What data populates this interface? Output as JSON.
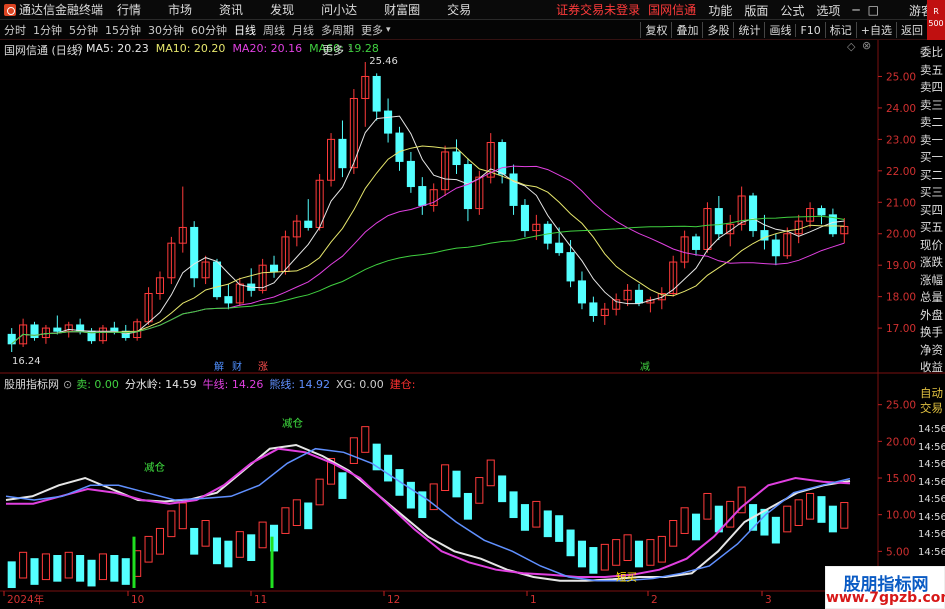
{
  "menubar": {
    "app_title": "通达信金融终端",
    "menus": [
      "行情",
      "市场",
      "资讯",
      "发现",
      "问小达",
      "财富圈",
      "交易"
    ],
    "warning": "证券交易未登录",
    "stock_name": "国网信通",
    "right_menus": [
      "功能",
      "版面",
      "公式",
      "选项"
    ],
    "guest": "游客"
  },
  "toolbar": {
    "timeframes": [
      "分时",
      "1分钟",
      "5分钟",
      "15分钟",
      "30分钟",
      "60分钟",
      "日线",
      "周线",
      "月线",
      "多周期",
      "更多"
    ],
    "active_timeframe": "日线",
    "right_buttons": [
      "复权",
      "叠加",
      "多股",
      "统计",
      "画线",
      "F10",
      "标记",
      "+自选",
      "返回"
    ],
    "corner_label": "R 500"
  },
  "main_chart": {
    "title": "国网信通 (日线)",
    "legend": [
      {
        "label": "MA5: 20.23",
        "color": "#e6e6e6"
      },
      {
        "label": "MA10: 20.20",
        "color": "#e6e66c"
      },
      {
        "label": "MA20: 20.16",
        "color": "#e040e0"
      },
      {
        "label": "MA60: 19.28",
        "color": "#40d040"
      }
    ],
    "more": "更多",
    "high_label": "25.46",
    "low_label": "16.24",
    "price_axis": [
      "25.00",
      "24.00",
      "23.00",
      "22.00",
      "21.00",
      "20.00",
      "19.00",
      "18.00",
      "17.00"
    ],
    "markers": [
      {
        "text": "解",
        "color": "#4f8fff"
      },
      {
        "text": "财",
        "color": "#4f8fff"
      },
      {
        "text": "涨",
        "color": "#ff4f4f"
      },
      {
        "text": "减",
        "color": "#40d040"
      }
    ]
  },
  "indicator": {
    "title": "股朋指标网",
    "legend": [
      {
        "label": "卖: 0.00",
        "color": "#40d040"
      },
      {
        "label": "分水岭: 14.59",
        "color": "#e6e6e6"
      },
      {
        "label": "牛线: 14.26",
        "color": "#e040e0"
      },
      {
        "label": "熊线: 14.92",
        "color": "#6090ff"
      },
      {
        "label": "XG: 0.00",
        "color": "#cccccc"
      },
      {
        "label": "建仓:",
        "color": "#ff3030"
      }
    ],
    "axis": [
      "25.00",
      "20.00",
      "15.00",
      "10.00",
      "5.00"
    ],
    "notes": [
      {
        "text": "减仓",
        "color": "#40e040"
      },
      {
        "text": "减仓",
        "color": "#40e040"
      },
      {
        "text": "短买",
        "color": "#ffe000"
      }
    ]
  },
  "date_axis": [
    "2024年",
    "10",
    "11",
    "12",
    "1",
    "2",
    "3"
  ],
  "right_panel": {
    "items": [
      "委比",
      "卖五",
      "卖四",
      "卖三",
      "卖二",
      "卖一",
      "买一",
      "买二",
      "买三",
      "买四",
      "买五",
      "现价",
      "涨跌",
      "涨幅",
      "总量",
      "外盘",
      "换手",
      "净资",
      "收益"
    ],
    "auto_trade": "自动交易",
    "times": [
      "14:56",
      "14:56",
      "14:56",
      "14:56",
      "14:56",
      "14:56",
      "14:56",
      "14:56"
    ]
  },
  "watermark": {
    "line1": "股朋指标网",
    "line2": "www.7gpzb.com"
  },
  "chart_data": {
    "type": "candlestick",
    "price_range": [
      16.24,
      25.46
    ],
    "ohlc": [
      [
        16.8,
        17.0,
        16.24,
        16.5
      ],
      [
        16.5,
        17.3,
        16.4,
        17.1
      ],
      [
        17.1,
        17.2,
        16.6,
        16.7
      ],
      [
        16.7,
        17.1,
        16.5,
        17.0
      ],
      [
        17.0,
        17.4,
        16.8,
        16.9
      ],
      [
        16.9,
        17.2,
        16.7,
        17.1
      ],
      [
        17.1,
        17.3,
        16.8,
        16.9
      ],
      [
        16.9,
        17.0,
        16.5,
        16.6
      ],
      [
        16.6,
        17.1,
        16.5,
        17.0
      ],
      [
        17.0,
        17.2,
        16.8,
        16.9
      ],
      [
        16.9,
        17.1,
        16.6,
        16.7
      ],
      [
        16.7,
        17.3,
        16.6,
        17.2
      ],
      [
        17.2,
        18.3,
        17.1,
        18.1
      ],
      [
        18.1,
        18.8,
        17.9,
        18.6
      ],
      [
        18.6,
        19.9,
        18.4,
        19.7
      ],
      [
        19.7,
        21.5,
        19.4,
        20.2
      ],
      [
        20.2,
        20.4,
        18.3,
        18.6
      ],
      [
        18.6,
        19.3,
        18.4,
        19.1
      ],
      [
        19.1,
        19.2,
        17.9,
        18.0
      ],
      [
        18.0,
        18.4,
        17.6,
        17.8
      ],
      [
        17.8,
        18.6,
        17.7,
        18.4
      ],
      [
        18.4,
        18.9,
        18.0,
        18.2
      ],
      [
        18.2,
        19.2,
        18.1,
        19.0
      ],
      [
        19.0,
        19.3,
        18.6,
        18.8
      ],
      [
        18.8,
        20.1,
        18.7,
        19.9
      ],
      [
        19.9,
        20.6,
        19.6,
        20.4
      ],
      [
        20.4,
        21.1,
        20.1,
        20.2
      ],
      [
        20.2,
        21.9,
        20.1,
        21.7
      ],
      [
        21.7,
        23.2,
        21.5,
        23.0
      ],
      [
        23.0,
        23.6,
        21.8,
        22.1
      ],
      [
        22.1,
        24.6,
        21.9,
        24.3
      ],
      [
        24.3,
        25.46,
        23.4,
        25.0
      ],
      [
        25.0,
        25.1,
        23.6,
        23.9
      ],
      [
        23.9,
        24.3,
        22.9,
        23.2
      ],
      [
        23.2,
        23.4,
        22.0,
        22.3
      ],
      [
        22.3,
        22.6,
        21.3,
        21.5
      ],
      [
        21.5,
        21.8,
        20.6,
        20.9
      ],
      [
        20.9,
        21.6,
        20.7,
        21.4
      ],
      [
        21.4,
        22.8,
        21.2,
        22.6
      ],
      [
        22.6,
        23.0,
        21.9,
        22.2
      ],
      [
        22.2,
        22.4,
        20.4,
        20.8
      ],
      [
        20.8,
        22.0,
        20.6,
        21.8
      ],
      [
        21.8,
        23.2,
        21.6,
        22.9
      ],
      [
        22.9,
        23.0,
        21.6,
        21.9
      ],
      [
        21.9,
        22.2,
        20.6,
        20.9
      ],
      [
        20.9,
        21.1,
        19.9,
        20.1
      ],
      [
        20.1,
        20.6,
        19.8,
        20.3
      ],
      [
        20.3,
        20.4,
        19.5,
        19.7
      ],
      [
        19.7,
        20.2,
        19.3,
        19.4
      ],
      [
        19.4,
        19.8,
        18.3,
        18.5
      ],
      [
        18.5,
        18.8,
        17.6,
        17.8
      ],
      [
        17.8,
        18.0,
        17.2,
        17.4
      ],
      [
        17.4,
        17.8,
        17.1,
        17.6
      ],
      [
        17.6,
        18.1,
        17.4,
        17.9
      ],
      [
        17.9,
        18.4,
        17.7,
        18.2
      ],
      [
        18.2,
        18.4,
        17.7,
        17.8
      ],
      [
        17.8,
        18.0,
        17.5,
        17.9
      ],
      [
        17.9,
        18.3,
        17.6,
        18.1
      ],
      [
        18.1,
        19.3,
        18.0,
        19.1
      ],
      [
        19.1,
        20.1,
        18.9,
        19.9
      ],
      [
        19.9,
        20.0,
        19.3,
        19.5
      ],
      [
        19.5,
        21.0,
        19.4,
        20.8
      ],
      [
        20.8,
        21.2,
        19.8,
        20.0
      ],
      [
        20.0,
        20.6,
        19.6,
        20.3
      ],
      [
        20.3,
        21.5,
        20.1,
        21.2
      ],
      [
        21.2,
        21.3,
        19.9,
        20.1
      ],
      [
        20.1,
        20.6,
        19.5,
        19.8
      ],
      [
        19.8,
        20.0,
        19.0,
        19.3
      ],
      [
        19.3,
        20.2,
        19.2,
        20.0
      ],
      [
        20.0,
        20.6,
        19.7,
        20.4
      ],
      [
        20.4,
        21.0,
        20.2,
        20.8
      ],
      [
        20.8,
        20.9,
        20.3,
        20.6
      ],
      [
        20.6,
        20.8,
        19.9,
        20.0
      ],
      [
        20.0,
        20.5,
        19.7,
        20.23
      ]
    ],
    "indicator_series": {
      "分水岭": [
        12.0,
        12.5,
        14.0,
        15.0,
        13.5,
        12.0,
        11.8,
        12.1,
        13.0,
        16.0,
        19.0,
        19.5,
        18.0,
        16.0,
        13.0,
        10.0,
        7.0,
        5.0,
        4.0,
        2.5,
        1.5,
        1.0,
        1.0,
        1.2,
        1.5,
        1.5,
        2.0,
        5.0,
        9.0,
        11.0,
        13.0,
        14.0,
        14.59
      ],
      "牛线": [
        11.5,
        11.5,
        12.5,
        13.5,
        13.0,
        12.0,
        11.5,
        12.0,
        14.0,
        17.0,
        19.0,
        18.5,
        17.0,
        15.0,
        11.5,
        8.0,
        5.0,
        3.5,
        2.5,
        2.0,
        1.8,
        1.5,
        1.5,
        1.8,
        2.5,
        4.0,
        7.0,
        11.0,
        14.0,
        15.0,
        14.5,
        14.26
      ],
      "熊线": [
        12.5,
        12.0,
        12.5,
        14.0,
        14.0,
        13.0,
        12.0,
        12.2,
        12.5,
        14.0,
        17.0,
        19.0,
        18.5,
        17.0,
        14.5,
        12.0,
        9.0,
        6.5,
        5.0,
        3.0,
        1.5,
        1.0,
        1.0,
        1.3,
        2.0,
        3.0,
        6.0,
        10.0,
        13.0,
        14.0,
        14.92
      ]
    }
  }
}
